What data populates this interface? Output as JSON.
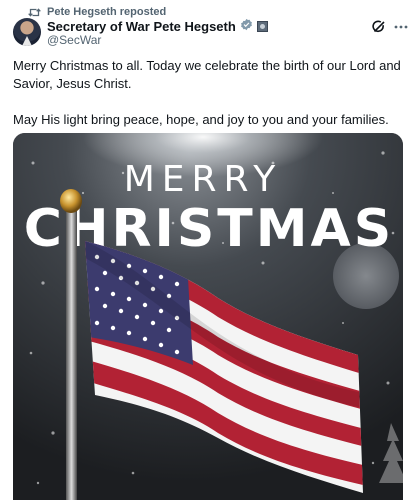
{
  "repost": {
    "icon": "repost-icon",
    "label": "Pete Hegseth reposted"
  },
  "author": {
    "name": "Secretary of War Pete Hegseth",
    "handle": "@SecWar",
    "verified_color": "#829aab",
    "avatar": "avatar"
  },
  "actions": {
    "grok_icon": "grok-icon",
    "more_icon": "more-icon"
  },
  "post": {
    "paragraph1": "Merry Christmas to all. Today we celebrate the birth of our Lord and Savior, Jesus Christ.",
    "paragraph2": "May His light bring peace, hope, and joy to you and your families."
  },
  "media": {
    "line1": "MERRY",
    "line2": "CHRISTMAS",
    "flag_red": "#b22234",
    "flag_blue": "#3c3b6e"
  }
}
